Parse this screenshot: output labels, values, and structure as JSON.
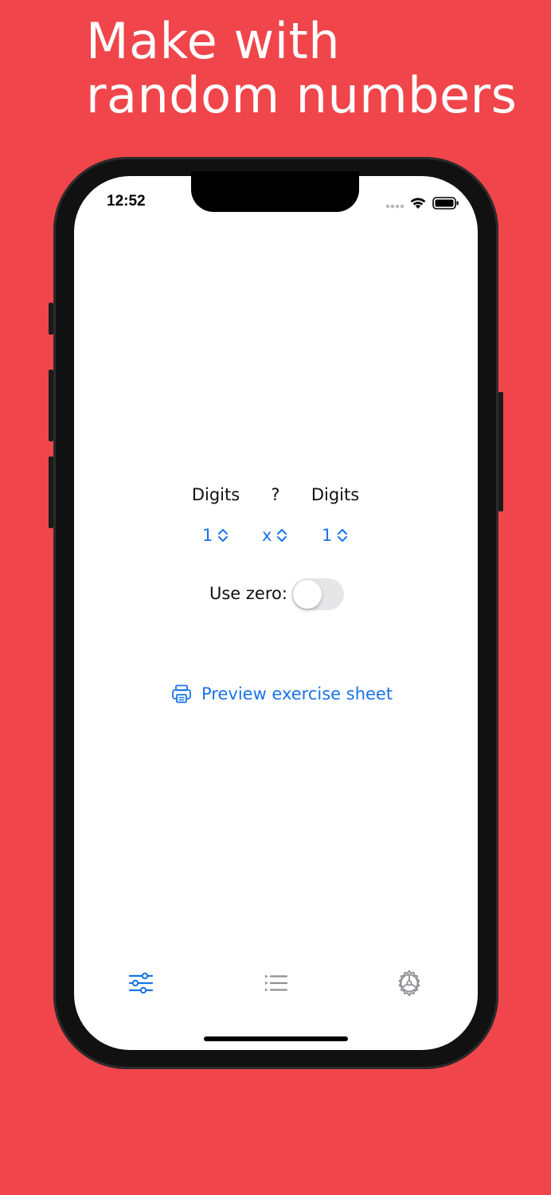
{
  "headline": {
    "line1": "Make with",
    "line2": "random numbers"
  },
  "status_bar": {
    "time": "12:52"
  },
  "form": {
    "left_header": "Digits",
    "operator_header": "?",
    "right_header": "Digits",
    "left_value": "1",
    "operator_value": "x",
    "right_value": "1",
    "use_zero_label": "Use zero:",
    "use_zero_on": false
  },
  "actions": {
    "preview_label": "Preview exercise sheet"
  },
  "tab_bar": {
    "items": [
      {
        "icon": "sliders-icon",
        "selected": true
      },
      {
        "icon": "list-icon",
        "selected": false
      },
      {
        "icon": "gear-icon",
        "selected": false
      }
    ]
  },
  "colors": {
    "background": "#f0464b",
    "accent": "#1a73e8",
    "inactive": "#8e8e93"
  }
}
